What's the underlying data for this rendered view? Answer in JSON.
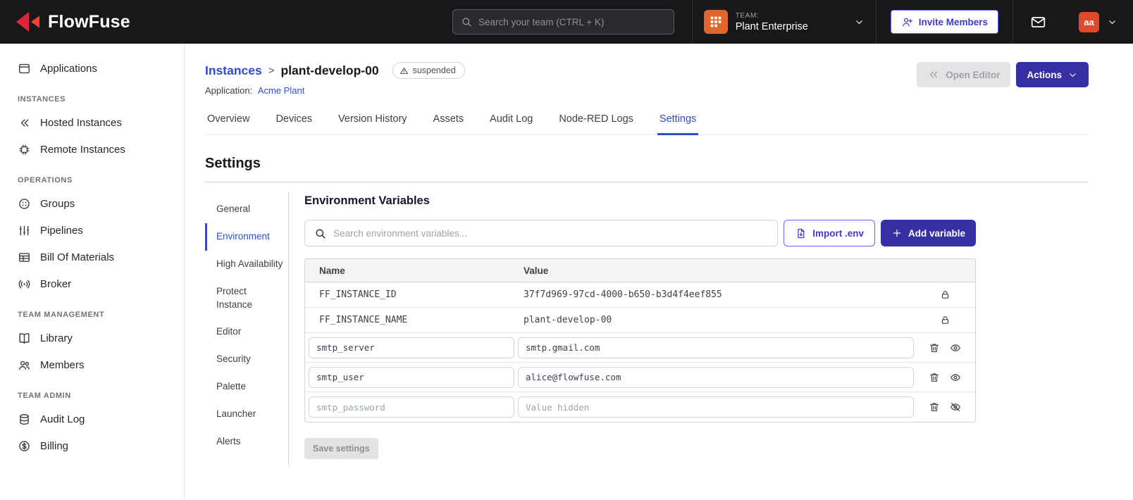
{
  "colors": {
    "brand_red": "#e0243a",
    "accent_indigo": "#3730a3",
    "link_blue": "#2f4cd0",
    "team_icon_orange": "#e0672c",
    "avatar_red": "#dd4a2b"
  },
  "navbar": {
    "brand": "FlowFuse",
    "search_placeholder": "Search your team (CTRL + K)",
    "team_label": "TEAM:",
    "team_name": "Plant Enterprise",
    "invite_button": "Invite Members",
    "avatar_initials": "aa"
  },
  "sidebar": {
    "sections": [
      {
        "label": "",
        "items": [
          {
            "label": "Applications",
            "icon": "applications"
          }
        ]
      },
      {
        "label": "INSTANCES",
        "items": [
          {
            "label": "Hosted Instances",
            "icon": "hosted"
          },
          {
            "label": "Remote Instances",
            "icon": "remote"
          }
        ]
      },
      {
        "label": "OPERATIONS",
        "items": [
          {
            "label": "Groups",
            "icon": "groups"
          },
          {
            "label": "Pipelines",
            "icon": "pipelines"
          },
          {
            "label": "Bill Of Materials",
            "icon": "bom"
          },
          {
            "label": "Broker",
            "icon": "broker"
          }
        ]
      },
      {
        "label": "TEAM MANAGEMENT",
        "items": [
          {
            "label": "Library",
            "icon": "library"
          },
          {
            "label": "Members",
            "icon": "members"
          }
        ]
      },
      {
        "label": "TEAM ADMIN",
        "items": [
          {
            "label": "Audit Log",
            "icon": "audit"
          },
          {
            "label": "Billing",
            "icon": "billing"
          }
        ]
      }
    ]
  },
  "header": {
    "breadcrumb_parent": "Instances",
    "breadcrumb_separator": ">",
    "breadcrumb_current": "plant-develop-00",
    "status_badge": "suspended",
    "application_label": "Application:",
    "application_name": "Acme Plant",
    "open_editor_button": "Open Editor",
    "actions_button": "Actions"
  },
  "tabs": [
    "Overview",
    "Devices",
    "Version History",
    "Assets",
    "Audit Log",
    "Node-RED Logs",
    "Settings"
  ],
  "active_tab": "Settings",
  "settings": {
    "title": "Settings",
    "nav": [
      "General",
      "Environment",
      "High Availability",
      "Protect Instance",
      "Editor",
      "Security",
      "Palette",
      "Launcher",
      "Alerts"
    ],
    "active_nav": "Environment",
    "section_title": "Environment Variables",
    "search_placeholder": "Search environment variables...",
    "import_button": "Import .env",
    "add_button": "Add variable",
    "save_button": "Save settings",
    "table": {
      "headers": [
        "Name",
        "Value"
      ],
      "locked_rows": [
        {
          "name": "FF_INSTANCE_ID",
          "value": "37f7d969-97cd-4000-b650-b3d4f4eef855"
        },
        {
          "name": "FF_INSTANCE_NAME",
          "value": "plant-develop-00"
        }
      ],
      "editable_rows": [
        {
          "name": "smtp_server",
          "value": "smtp.gmail.com",
          "hidden": false,
          "muted": false
        },
        {
          "name": "smtp_user",
          "value": "alice@flowfuse.com",
          "hidden": false,
          "muted": false
        },
        {
          "name": "smtp_password",
          "value": "",
          "value_placeholder": "Value hidden",
          "hidden": true,
          "muted": true
        }
      ]
    }
  }
}
